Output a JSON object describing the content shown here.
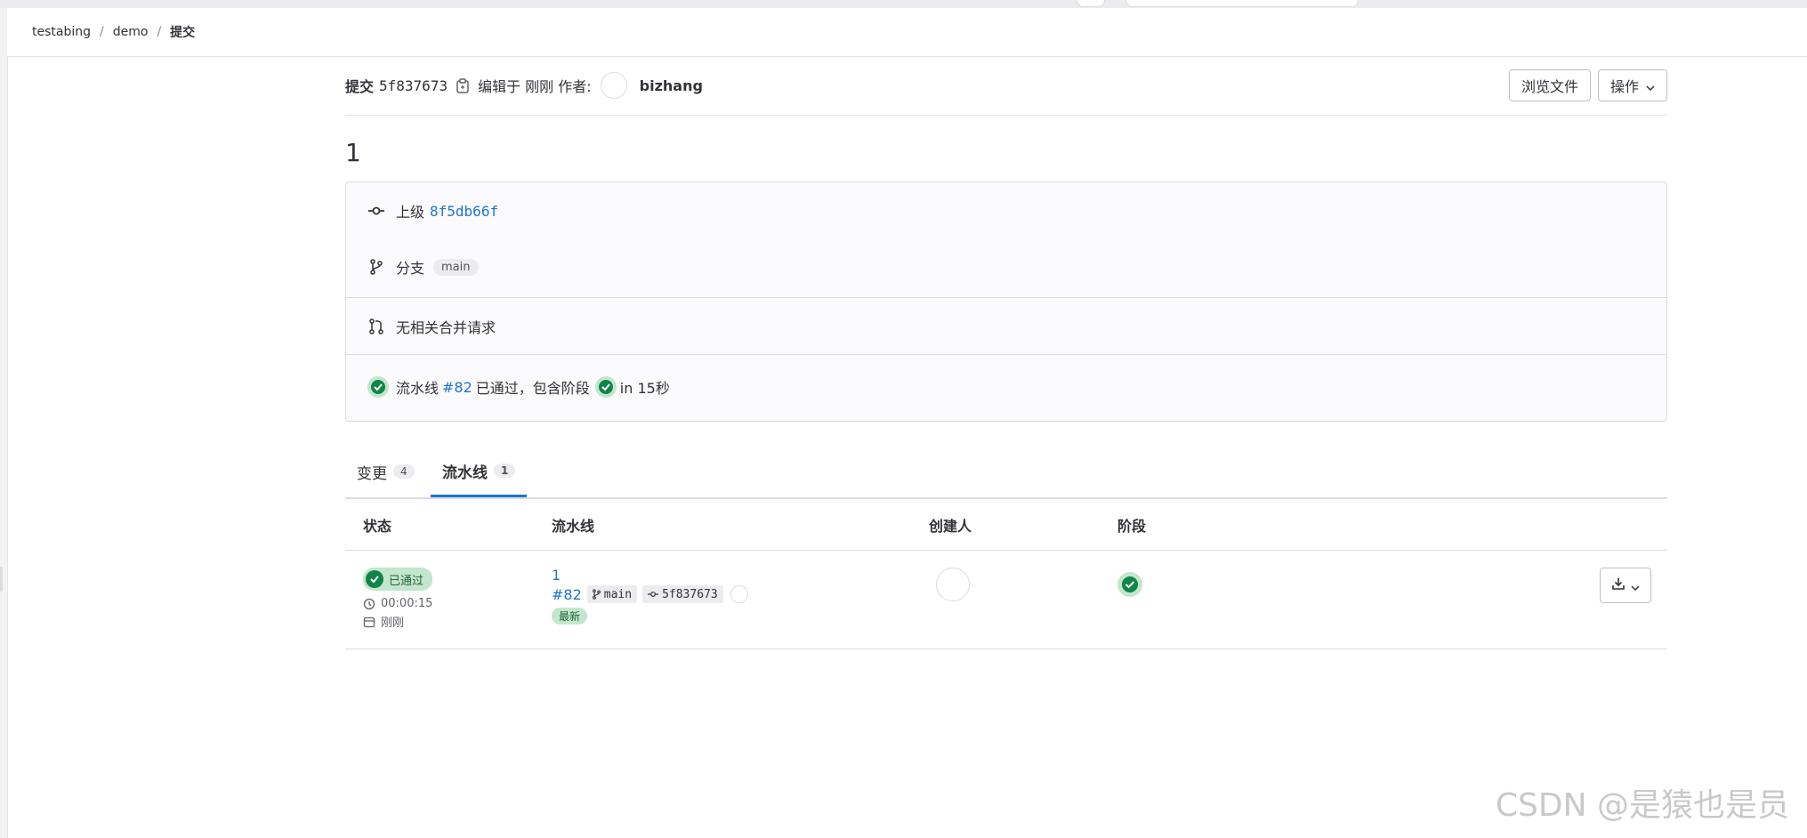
{
  "breadcrumb": [
    "testabing",
    "demo",
    "提交"
  ],
  "commit": {
    "title_label": "提交",
    "sha": "5f837673",
    "edited_text": "编辑于 刚刚 作者:",
    "author": "bizhang",
    "message": "1"
  },
  "actions": {
    "browse_files": "浏览文件",
    "operations": "操作"
  },
  "info": {
    "parent_label": "上级",
    "parent_sha": "8f5db66f",
    "branch_label": "分支",
    "branch_name": "main",
    "no_mr_text": "无相关合并请求",
    "pipeline_prefix": "流水线",
    "pipeline_id": "#82",
    "pipeline_status_text": "已通过，包含阶段",
    "pipeline_duration": "in 15秒"
  },
  "tabs": [
    {
      "label": "变更",
      "count": "4"
    },
    {
      "label": "流水线",
      "count": "1"
    }
  ],
  "table": {
    "headers": [
      "状态",
      "流水线",
      "创建人",
      "阶段"
    ],
    "rows": [
      {
        "status": "已通过",
        "duration": "00:00:15",
        "finished": "刚刚",
        "pipeline_name": "1",
        "pipeline_id": "#82",
        "branch": "main",
        "sha": "5f837673",
        "tag": "最新"
      }
    ]
  },
  "watermark": "CSDN @是猿也是员",
  "colors": {
    "link": "#1f75cb",
    "success": "#108548",
    "success_bg": "#c3e6cd",
    "border": "#dcdcde"
  },
  "icons": [
    "copy-icon",
    "commit-icon",
    "branch-icon",
    "merge-request-icon",
    "check-circle-icon",
    "clock-icon",
    "calendar-icon",
    "download-icon",
    "chevron-down-icon"
  ]
}
